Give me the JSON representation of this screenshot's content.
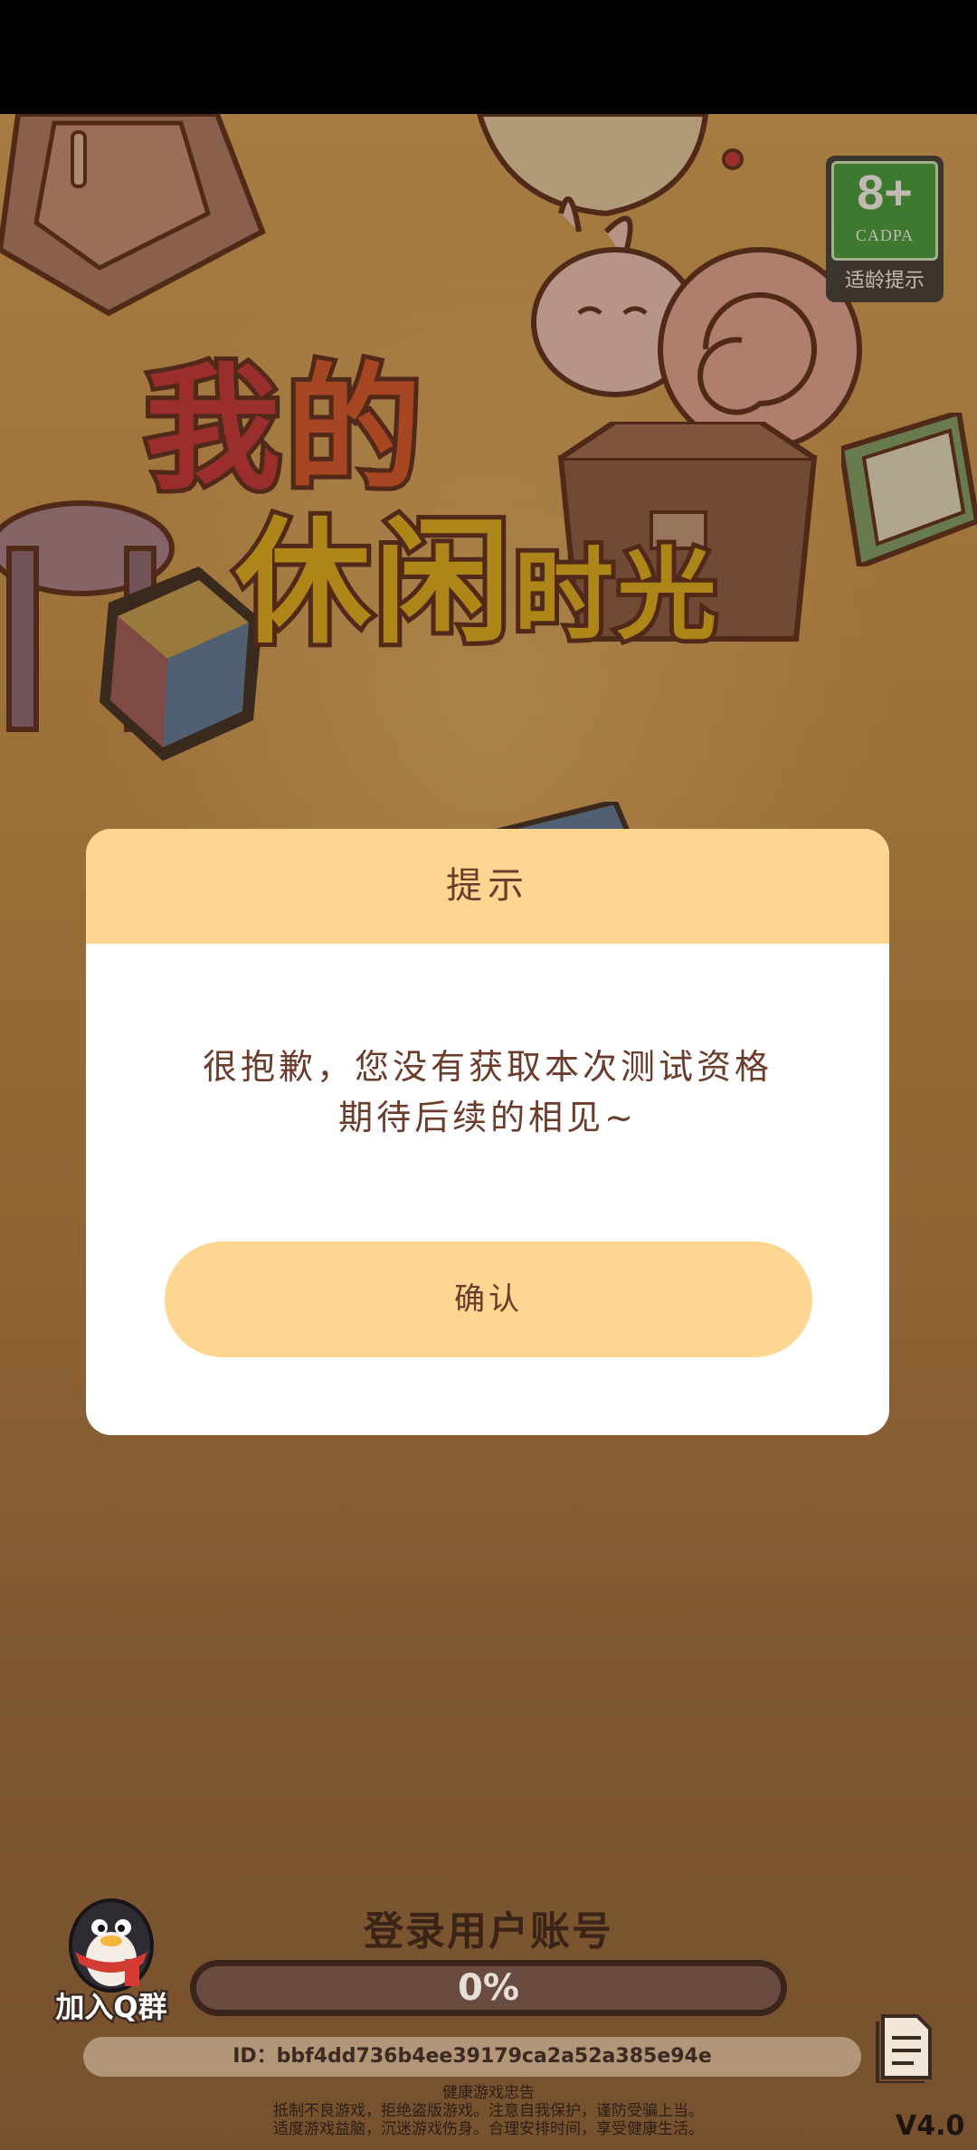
{
  "age_badge": {
    "rating": "8+",
    "org": "CADPA",
    "label": "适龄提示"
  },
  "title": {
    "line1_a": "我",
    "line1_b": "的",
    "line2_a": "休闲",
    "line2_b": "时光"
  },
  "dialog": {
    "title": "提示",
    "message_line1": "很抱歉，您没有获取本次测试资格",
    "message_line2": "期待后续的相见~",
    "confirm_label": "确认"
  },
  "bottom": {
    "qq_group_label": "加入Q群",
    "login_status": "登录用户账号",
    "progress_text": "0%",
    "progress_value": 0,
    "user_id": "ID：bbf4dd736b4ee39179ca2a52a385e94e",
    "health_title": "健康游戏忠告",
    "health_line1": "抵制不良游戏，拒绝盗版游戏。注意自我保护，谨防受骗上当。",
    "health_line2": "适度游戏益脑，沉迷游戏伤身。合理安排时间，享受健康生活。",
    "version": "V4.0"
  },
  "colors": {
    "dialog_accent": "#fed591",
    "dialog_text": "#6b3b2b",
    "age_green": "#3e9f3b"
  }
}
